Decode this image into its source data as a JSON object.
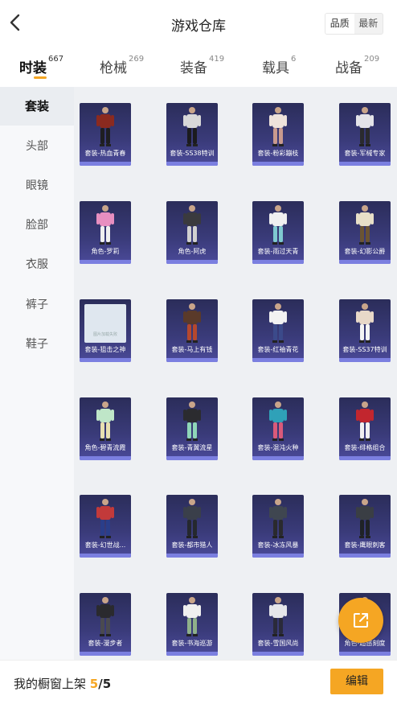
{
  "header": {
    "title": "游戏仓库",
    "sort": [
      {
        "label": "品质"
      },
      {
        "label": "最新"
      }
    ]
  },
  "tabs": [
    {
      "label": "时装",
      "count": "667"
    },
    {
      "label": "枪械",
      "count": "269"
    },
    {
      "label": "装备",
      "count": "419"
    },
    {
      "label": "载具",
      "count": "6"
    },
    {
      "label": "战备",
      "count": "209"
    }
  ],
  "sidebar": [
    {
      "label": "套装"
    },
    {
      "label": "头部"
    },
    {
      "label": "眼镜"
    },
    {
      "label": "脸部"
    },
    {
      "label": "衣服"
    },
    {
      "label": "裤子"
    },
    {
      "label": "鞋子"
    }
  ],
  "items": [
    {
      "label": "套装-热血青春",
      "colors": [
        "#8b2a1f",
        "#1e1e22"
      ]
    },
    {
      "label": "套装-SS38特训",
      "colors": [
        "#d8d8d8",
        "#1b1b1e"
      ]
    },
    {
      "label": "套装-粉彩蹦枝",
      "colors": [
        "#efe3db",
        "#c89a8e"
      ]
    },
    {
      "label": "套装-军械专家",
      "colors": [
        "#e4e4e8",
        "#2a2a2e"
      ]
    },
    {
      "label": "角色-罗莉",
      "colors": [
        "#e88fc0",
        "#f0f0f0"
      ]
    },
    {
      "label": "角色-阿虎",
      "colors": [
        "#3a3a3e",
        "#d0d0d0"
      ]
    },
    {
      "label": "套装-雨过天青",
      "colors": [
        "#f0f0f0",
        "#7fc9d0"
      ]
    },
    {
      "label": "套装-幻影公爵",
      "colors": [
        "#e8e0c8",
        "#6b5433"
      ]
    },
    {
      "label": "套装-狙击之神",
      "placeholder": true,
      "colors": [
        "#dfe7ef",
        "#9ab"
      ]
    },
    {
      "label": "套装-马上有钱",
      "colors": [
        "#5a3a2a",
        "#b5482e"
      ]
    },
    {
      "label": "套装-红袖青花",
      "colors": [
        "#f2f2f2",
        "#3b4a8a"
      ]
    },
    {
      "label": "套装-SS37特训",
      "colors": [
        "#e8d8c8",
        "#f4f4f4"
      ]
    },
    {
      "label": "角色-碧青流霞",
      "colors": [
        "#bfe6c8",
        "#e8e0b0"
      ]
    },
    {
      "label": "套装-青翼流星",
      "colors": [
        "#2b2b2f",
        "#8fd6b8"
      ]
    },
    {
      "label": "套装-混沌火种",
      "colors": [
        "#2fa1b8",
        "#d95a7a"
      ]
    },
    {
      "label": "套装-绯格组合",
      "colors": [
        "#c2262e",
        "#f0f0f0"
      ]
    },
    {
      "label": "套装-幻世战...",
      "colors": [
        "#c23a3a",
        "#2a3e8a"
      ]
    },
    {
      "label": "套装-都市猎人",
      "colors": [
        "#3a3f4a",
        "#25282e"
      ]
    },
    {
      "label": "套装-冰冻风暴",
      "colors": [
        "#3f4650",
        "#2a2a2e"
      ]
    },
    {
      "label": "套装-鹰眼刺客",
      "colors": [
        "#3a3e44",
        "#1f2226"
      ]
    },
    {
      "label": "套装-漫步者",
      "colors": [
        "#2a2a2e",
        "#4a4a50"
      ]
    },
    {
      "label": "套装-书海巡游",
      "colors": [
        "#f0f0f0",
        "#8fb08a"
      ]
    },
    {
      "label": "套装-雪国风尚",
      "colors": [
        "#e6e6ea",
        "#2a2a3a"
      ]
    },
    {
      "label": "角色-超感刻度",
      "colors": [
        "#3a3e44",
        "#1f2226"
      ]
    }
  ],
  "placeholder_text": "图片加载失败",
  "footer": {
    "shelf_label": "我的橱窗上架",
    "shelf_current": "5",
    "shelf_total": "/5",
    "edit_label": "编辑"
  },
  "accent": "#f5a623",
  "icons": {
    "back": "chevron-left-icon",
    "fab": "share-external-icon"
  }
}
